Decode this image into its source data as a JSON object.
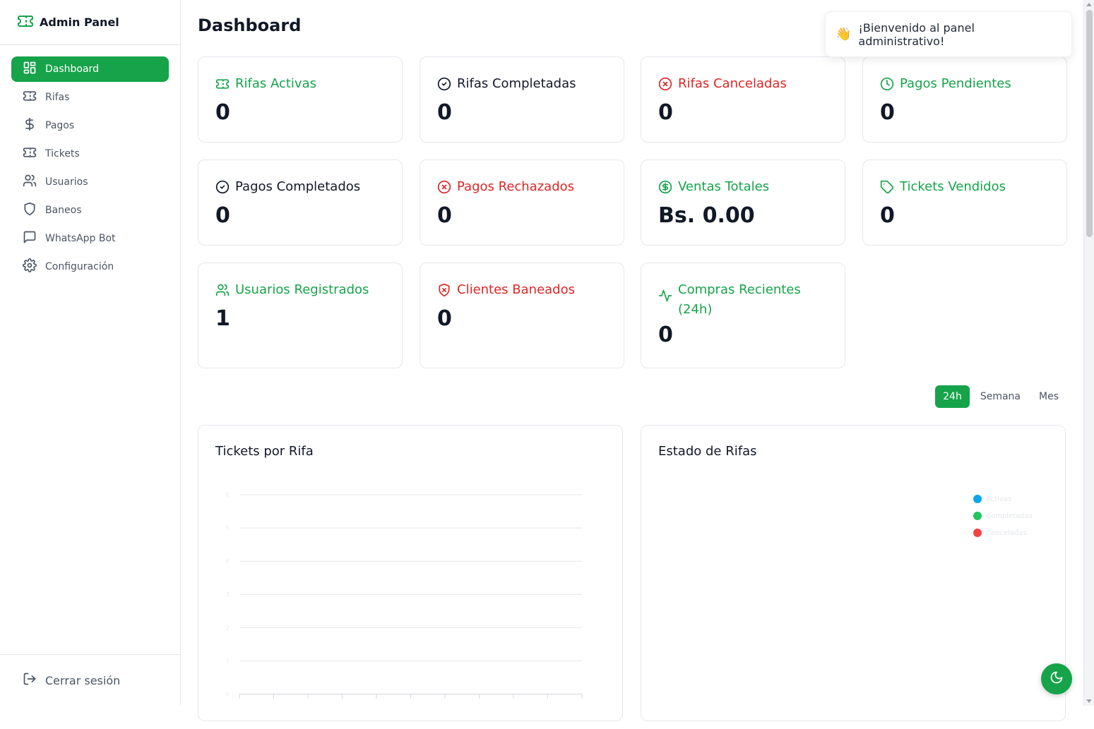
{
  "app": {
    "title": "Admin Panel",
    "brand_icon": "ticket-icon",
    "accent": "#16a34a"
  },
  "sidebar": {
    "items": [
      {
        "label": "Dashboard",
        "icon": "dashboard-icon",
        "active": true
      },
      {
        "label": "Rifas",
        "icon": "ticket-icon"
      },
      {
        "label": "Pagos",
        "icon": "dollar-icon"
      },
      {
        "label": "Tickets",
        "icon": "ticket-icon"
      },
      {
        "label": "Usuarios",
        "icon": "users-icon"
      },
      {
        "label": "Baneos",
        "icon": "shield-icon"
      },
      {
        "label": "WhatsApp Bot",
        "icon": "chat-icon"
      },
      {
        "label": "Configuración",
        "icon": "gear-icon"
      }
    ],
    "logout_label": "Cerrar sesión"
  },
  "main": {
    "title": "Dashboard"
  },
  "stats": [
    {
      "label": "Rifas Activas",
      "value": "0",
      "color": "#16a34a",
      "icon": "ticket-icon"
    },
    {
      "label": "Rifas Completadas",
      "value": "0",
      "color": "#111827",
      "icon": "check-circle-icon"
    },
    {
      "label": "Rifas Canceladas",
      "value": "0",
      "color": "#dc2626",
      "icon": "x-circle-icon"
    },
    {
      "label": "Pagos Pendientes",
      "value": "0",
      "color": "#16a34a",
      "icon": "clock-icon"
    },
    {
      "label": "Pagos Completados",
      "value": "0",
      "color": "#111827",
      "icon": "check-circle-icon"
    },
    {
      "label": "Pagos Rechazados",
      "value": "0",
      "color": "#dc2626",
      "icon": "x-circle-icon"
    },
    {
      "label": "Ventas Totales",
      "value": "Bs. 0.00",
      "color": "#16a34a",
      "icon": "dollar-circle-icon"
    },
    {
      "label": "Tickets Vendidos",
      "value": "0",
      "color": "#16a34a",
      "icon": "tag-icon"
    },
    {
      "label": "Usuarios Registrados",
      "value": "1",
      "color": "#16a34a",
      "icon": "users-icon"
    },
    {
      "label": "Clientes Baneados",
      "value": "0",
      "color": "#dc2626",
      "icon": "shield-x-icon"
    },
    {
      "label": "Compras Recientes (24h)",
      "value": "0",
      "color": "#16a34a",
      "icon": "activity-icon"
    }
  ],
  "range": {
    "options": [
      "24h",
      "Semana",
      "Mes"
    ],
    "selected": "24h"
  },
  "charts": {
    "tickets_title": "Tickets por Rifa",
    "estado_title": "Estado de Rifas",
    "estado_legend": [
      {
        "name": "Activas",
        "color": "#0ea5e9"
      },
      {
        "name": "Completadas",
        "color": "#22c55e"
      },
      {
        "name": "Canceladas",
        "color": "#ef4444"
      }
    ]
  },
  "chart_data": [
    {
      "type": "bar",
      "title": "Tickets por Rifa",
      "categories": [],
      "values": [],
      "yticks": [
        "6",
        "5",
        "4",
        "3",
        "2",
        "1",
        "0"
      ],
      "ylim": [
        0,
        6
      ],
      "grid": true
    },
    {
      "type": "pie",
      "title": "Estado de Rifas",
      "labels": [
        "Activas",
        "Completadas",
        "Canceladas"
      ],
      "values": [
        0,
        0,
        0
      ],
      "legend": "top-right"
    }
  ],
  "toast": {
    "emoji": "👋",
    "message": "¡Bienvenido al panel administrativo!"
  },
  "theme_toggle": {
    "icon": "moon-icon"
  }
}
